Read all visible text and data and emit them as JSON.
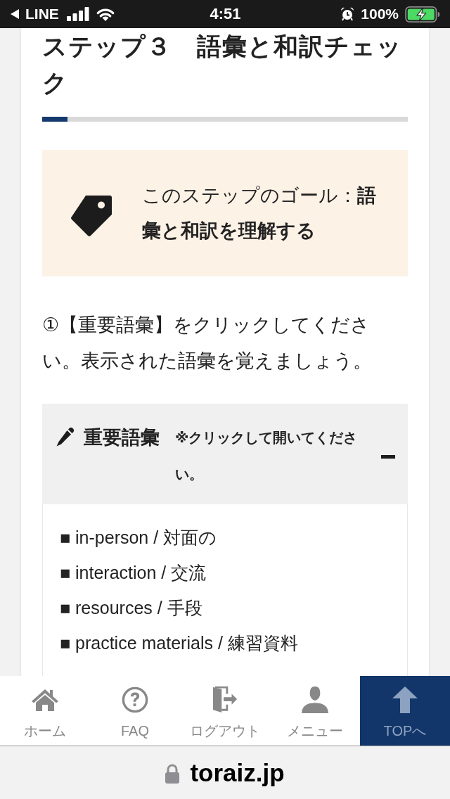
{
  "status_bar": {
    "back_label": "LINE",
    "time": "4:51",
    "alarm": true,
    "battery_percent": "100%",
    "charging": true
  },
  "step": {
    "title": "ステップ３　語彙と和訳チェック",
    "progress": {
      "level": 0.07
    }
  },
  "goal": {
    "text": "このステップのゴール：**語彙と和訳を理解する**"
  },
  "instruction": "①【重要語彙】をクリックしてください。表示された語彙を覚えましょう。",
  "vocabulary": {
    "title": "重要語彙",
    "note": "※クリックして開いてください。",
    "expanded": true,
    "items": [
      "■ in-person / 対面の",
      "■ interaction / 交流",
      "■ resources / 手段",
      "■ practice materials / 練習資料"
    ]
  },
  "bottom_nav": [
    {
      "kind": "home",
      "label": "ホーム",
      "highlighted": false
    },
    {
      "kind": "faq",
      "label": "FAQ",
      "highlighted": false
    },
    {
      "kind": "logout",
      "label": "ログアウト",
      "highlighted": false
    },
    {
      "kind": "menu",
      "label": "メニュー",
      "highlighted": false
    },
    {
      "kind": "top",
      "label": "TOPへ",
      "highlighted": true
    }
  ],
  "browser_bar": {
    "url": "toraiz.jp",
    "secure": true
  }
}
